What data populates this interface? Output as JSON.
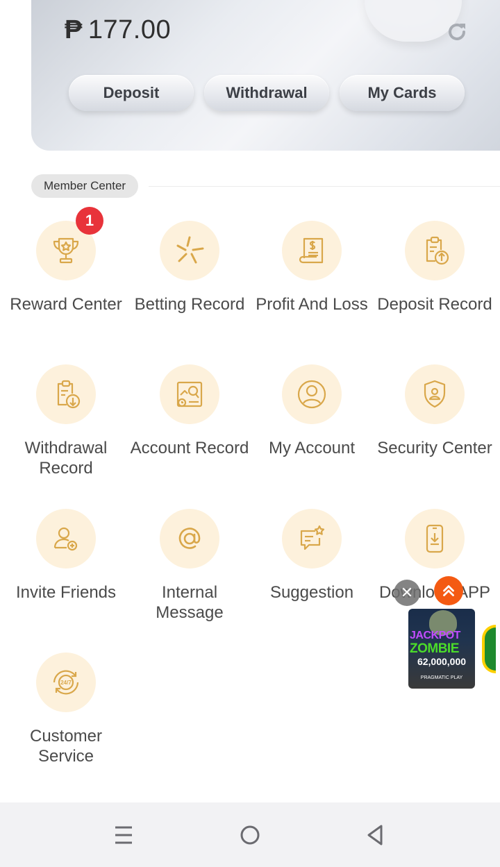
{
  "wallet": {
    "currency_symbol": "₱",
    "balance": "177.00",
    "buttons": {
      "deposit": "Deposit",
      "withdrawal": "Withdrawal",
      "my_cards": "My Cards"
    },
    "refresh_icon": "refresh-icon"
  },
  "member_center": {
    "title": "Member Center",
    "items": [
      {
        "label": "Reward Center",
        "icon": "trophy-icon",
        "badge": "1"
      },
      {
        "label": "Betting Record",
        "icon": "sparkle-icon"
      },
      {
        "label": "Profit And Loss",
        "icon": "receipt-dollar-icon"
      },
      {
        "label": "Deposit Record",
        "icon": "clipboard-upload-icon"
      },
      {
        "label": "Withdrawal Record",
        "icon": "clipboard-download-icon"
      },
      {
        "label": "Account Record",
        "icon": "chart-magnifier-icon"
      },
      {
        "label": "My Account",
        "icon": "user-circle-icon"
      },
      {
        "label": "Security Center",
        "icon": "shield-user-icon"
      },
      {
        "label": "Invite Friends",
        "icon": "user-add-icon"
      },
      {
        "label": "Internal Message",
        "icon": "at-sign-icon"
      },
      {
        "label": "Suggestion",
        "icon": "chat-star-icon"
      },
      {
        "label": "Download APP",
        "icon": "phone-download-icon"
      },
      {
        "label": "Customer Service",
        "icon": "support-24-7-icon"
      }
    ]
  },
  "ad": {
    "title_line1": "JACKPOT",
    "title_line2": "ZOMBIE",
    "amount": "62,000,000",
    "provider": "PRAGMATIC PLAY",
    "close_label": "✕"
  },
  "colors": {
    "icon_bg": "#fdf1dc",
    "icon_stroke": "#d9a74a",
    "badge": "#e8333a",
    "scroll_top": "#f45a12"
  }
}
